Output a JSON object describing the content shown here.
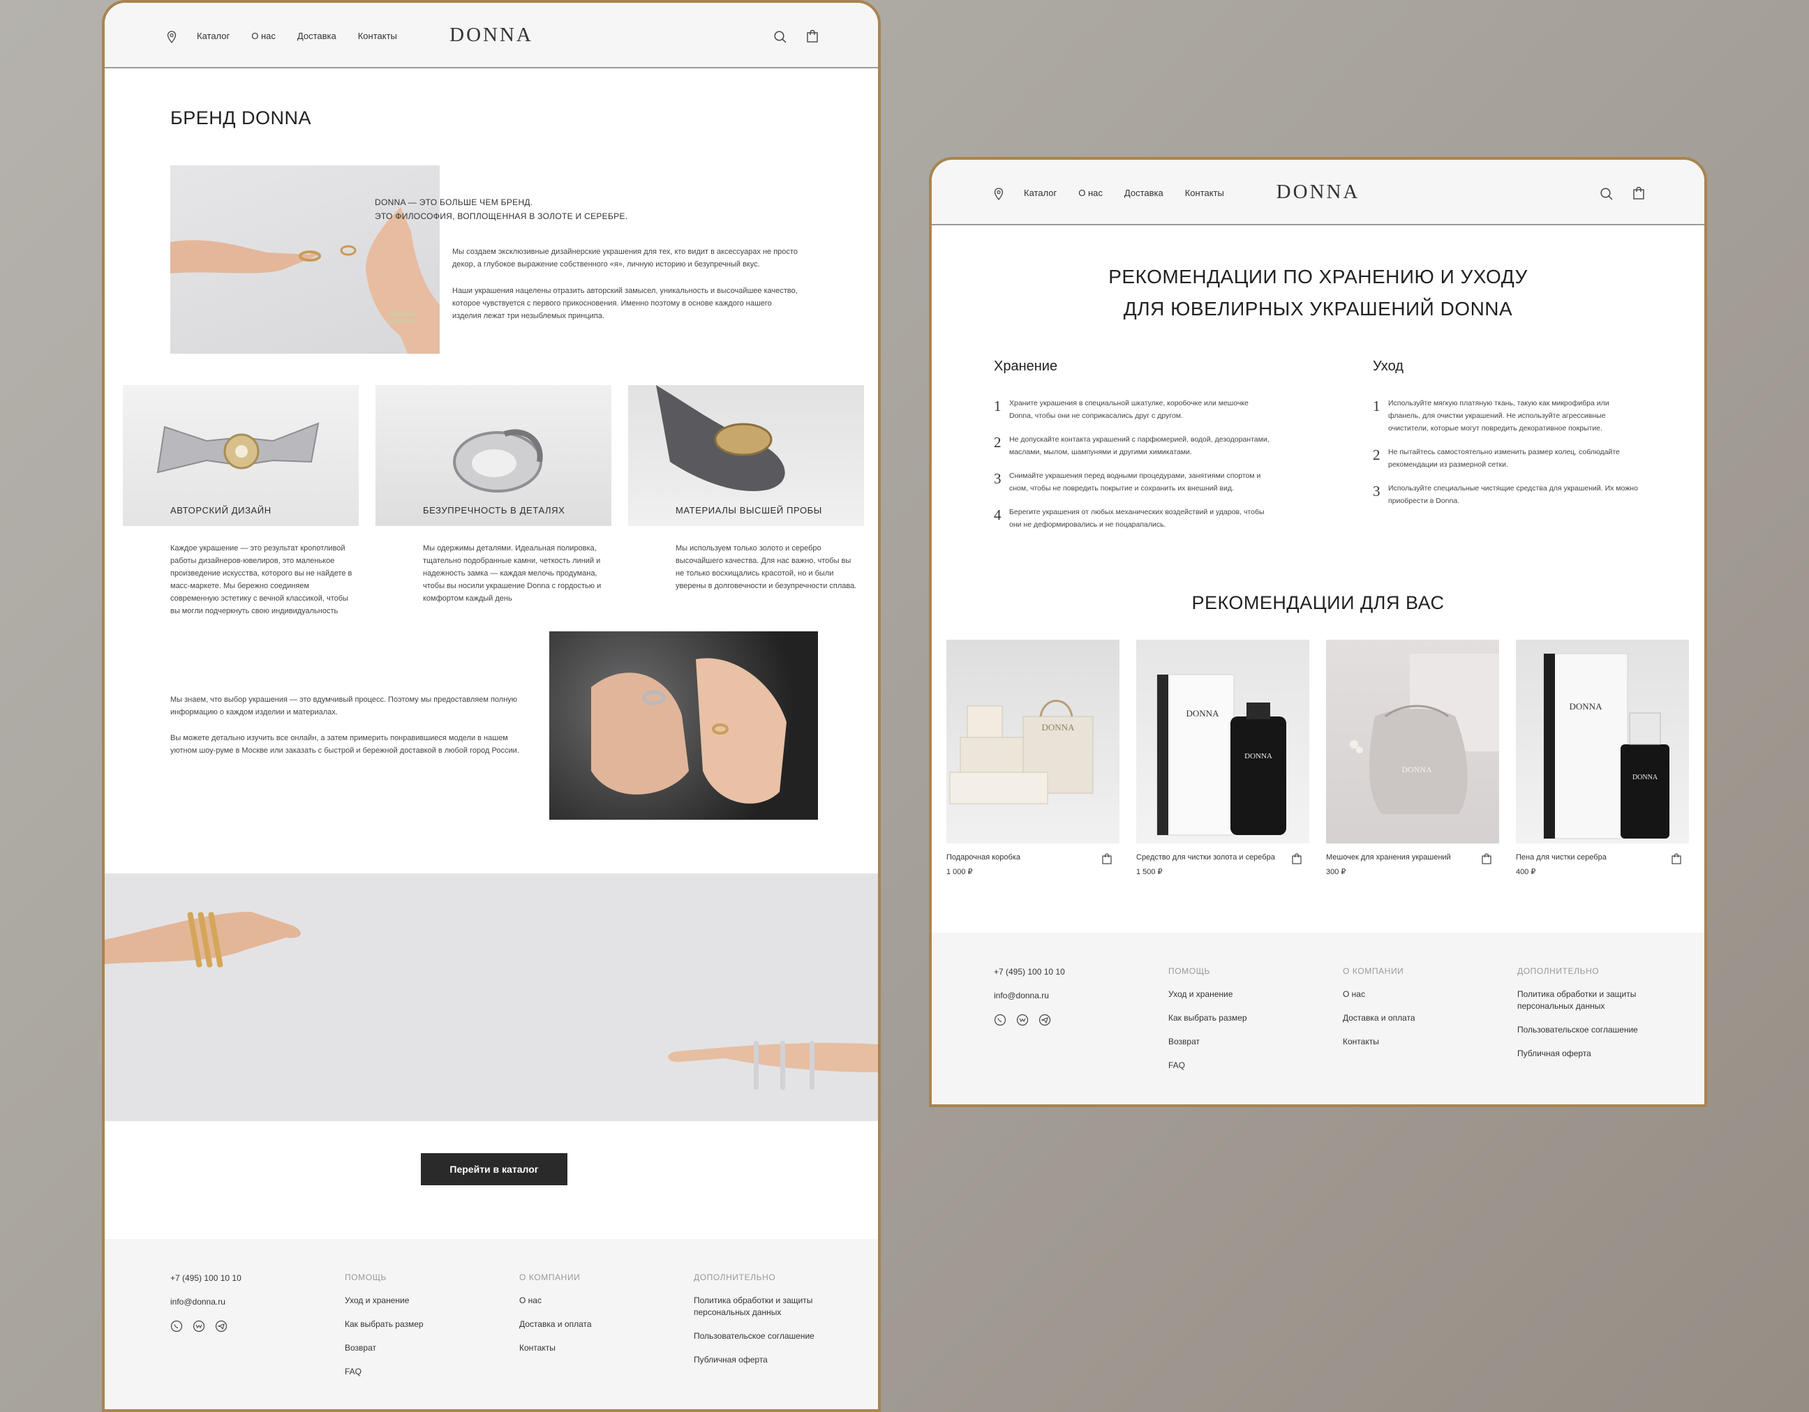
{
  "nav": {
    "items": [
      "Каталог",
      "О нас",
      "Доставка",
      "Контакты"
    ],
    "logo": "DONNA"
  },
  "about": {
    "title": "БРЕНД DONNA",
    "tagline_1": "DONNA — ЭТО БОЛЬШЕ ЧЕМ БРЕНД.",
    "tagline_2": "ЭТО ФИЛОСОФИЯ, ВОПЛОЩЕННАЯ В ЗОЛОТЕ И СЕРЕБРЕ.",
    "para_1": "Мы создаем эксклюзивные дизайнерские украшения для тех, кто видит в аксессуарах не просто декор, а глубокое выражение собственного «я», личную историю и безупречный вкус.",
    "para_2": "Наши украшения нацелены отразить авторский замысел, уникальность и высочайшее качество, которое чувствуется с первого прикосновения. Именно поэтому в основе каждого нашего изделия лежат три незыблемых принципа.",
    "principles": [
      {
        "title": "АВТОРСКИЙ ДИЗАЙН",
        "text": "Каждое украшение — это результат кропотливой работы дизайнеров-ювелиров, это маленькое произведение искусства, которого вы не найдете в масс-маркете. Мы бережно соединяем современную эстетику с вечной классикой, чтобы вы могли подчеркнуть свою индивидуальность"
      },
      {
        "title": "БЕЗУПРЕЧНОСТЬ В ДЕТАЛЯХ",
        "text": "Мы одержимы деталями. Идеальная полировка, тщательно подобранные камни, четкость линий и надежность замка — каждая мелочь продумана, чтобы вы носили украшение Donna с гордостью и комфортом каждый день"
      },
      {
        "title": "МАТЕРИАЛЫ ВЫСШЕЙ ПРОБЫ",
        "text": "Мы используем только золото и серебро высочайшего качества. Для нас важно, чтобы вы не только восхищались красотой, но и были уверены в долговечности и безупречности сплава."
      }
    ],
    "choice_para_1": "Мы знаем, что выбор украшения — это вдумчивый процесс. Поэтому мы предоставляем полную информацию о каждом изделии и материалах.",
    "choice_para_2": "Вы можете детально изучить все онлайн, а затем примерить понравившиеся модели в нашем уютном шоу-руме в Москве или заказать с быстрой и бережной доставкой в любой город России.",
    "cta": "Перейти в каталог"
  },
  "care": {
    "title_1": "РЕКОМЕНДАЦИИ ПО ХРАНЕНИЮ И УХОДУ",
    "title_2": "ДЛЯ ЮВЕЛИРНЫХ УКРАШЕНИЙ DONNA",
    "storage": {
      "heading": "Хранение",
      "steps": [
        {
          "num": "1",
          "text": "Храните украшения в специальной шкатулке, коробочке или мешочке Donna, чтобы они не соприкасались друг с другом."
        },
        {
          "num": "2",
          "text": "Не допускайте контакта украшений с парфюмерией, водой, дезодорантами, маслами, мылом, шампунями и другими химикатами."
        },
        {
          "num": "3",
          "text": "Снимайте украшения перед водными процедурами, занятиями спортом и сном, чтобы не повредить покрытие и сохранить их внешний вид."
        },
        {
          "num": "4",
          "text": "Берегите украшения от любых механических воздействий и ударов, чтобы они не деформировались и не поцарапались."
        }
      ]
    },
    "care": {
      "heading": "Уход",
      "steps": [
        {
          "num": "1",
          "text": "Используйте мягкую платяную ткань, такую как микрофибра или фланель, для очистки украшений. Не используйте агрессивные очистители, которые могут повредить декоративное покрытие."
        },
        {
          "num": "2",
          "text": "Не пытайтесь самостоятельно изменить размер колец, соблюдайте рекомендации из размерной сетки."
        },
        {
          "num": "3",
          "text": "Используйте специальные чистящие средства для украшений. Их можно приобрести в Donna."
        }
      ]
    },
    "reco_title": "РЕКОМЕНДАЦИИ ДЛЯ ВАС",
    "products": [
      {
        "name": "Подарочная коробка",
        "price": "1 000 ₽"
      },
      {
        "name": "Средство для чистки золота и  серебра",
        "price": "1 500 ₽"
      },
      {
        "name": "Мешочек для хранения украшений",
        "price": "300 ₽"
      },
      {
        "name": "Пена для чистки серебра",
        "price": "400 ₽"
      }
    ],
    "packaging_text": {
      "brand": "DONNA"
    }
  },
  "footer": {
    "phone": "+7 (495) 100 10 10",
    "email": "info@donna.ru",
    "help": {
      "heading": "ПОМОЩЬ",
      "items": [
        "Уход и хранение",
        "Как выбрать размер",
        "Возврат",
        "FAQ"
      ]
    },
    "company": {
      "heading": "О КОМПАНИИ",
      "items": [
        "О нас",
        "Доставка и оплата",
        "Контакты"
      ]
    },
    "extra": {
      "heading": "ДОПОЛНИТЕЛЬНО",
      "items": [
        "Политика обработки и защиты персональных данных",
        "Пользовательское соглашение",
        "Публичная оферта"
      ]
    }
  },
  "colors": {
    "panel_border": "#a9844f",
    "button": "#2a2a2a",
    "footer_bg": "#f5f5f5",
    "header_bg": "#f6f6f6"
  }
}
